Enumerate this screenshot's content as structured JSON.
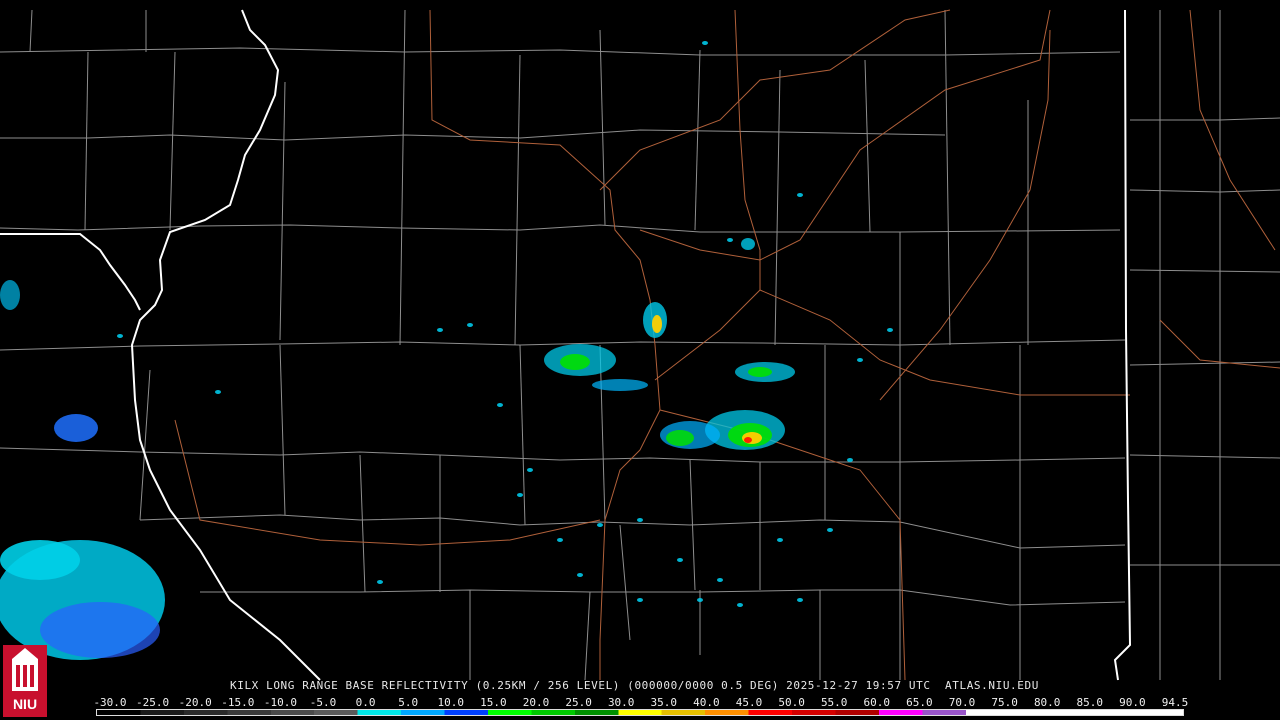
{
  "product": {
    "caption": "KILX LONG RANGE BASE REFLECTIVITY (0.25KM / 256 LEVEL) (000000/0000 0.5 DEG) 2025-12-27 19:57 UTC  ATLAS.NIU.EDU"
  },
  "logo": {
    "text": "NIU",
    "color": "#c8102e"
  },
  "colors": {
    "background": "#000000",
    "county_border": "#9a9a9a",
    "state_border": "#ffffff",
    "highway": "#b0603a"
  },
  "legend": {
    "ticks": [
      "-30.0",
      "-25.0",
      "-20.0",
      "-15.0",
      "-10.0",
      "-5.0",
      "0.0",
      "5.0",
      "10.0",
      "15.0",
      "20.0",
      "25.0",
      "30.0",
      "35.0",
      "40.0",
      "45.0",
      "50.0",
      "55.0",
      "60.0",
      "65.0",
      "70.0",
      "75.0",
      "80.0",
      "85.0",
      "90.0",
      "94.5"
    ],
    "colors": [
      "#000000",
      "#1a1a1a",
      "#2a2a2a",
      "#3a3a3a",
      "#4a4a4a",
      "#5a5a5a",
      "#00e5e5",
      "#00a8ff",
      "#0040ff",
      "#00ff00",
      "#00c800",
      "#009000",
      "#ffff00",
      "#e6c000",
      "#ff9000",
      "#ff0000",
      "#d40000",
      "#b00000",
      "#ff00ff",
      "#9955c9",
      "#ffffff",
      "#ffffff",
      "#ffffff",
      "#ffffff",
      "#ffffff"
    ]
  }
}
